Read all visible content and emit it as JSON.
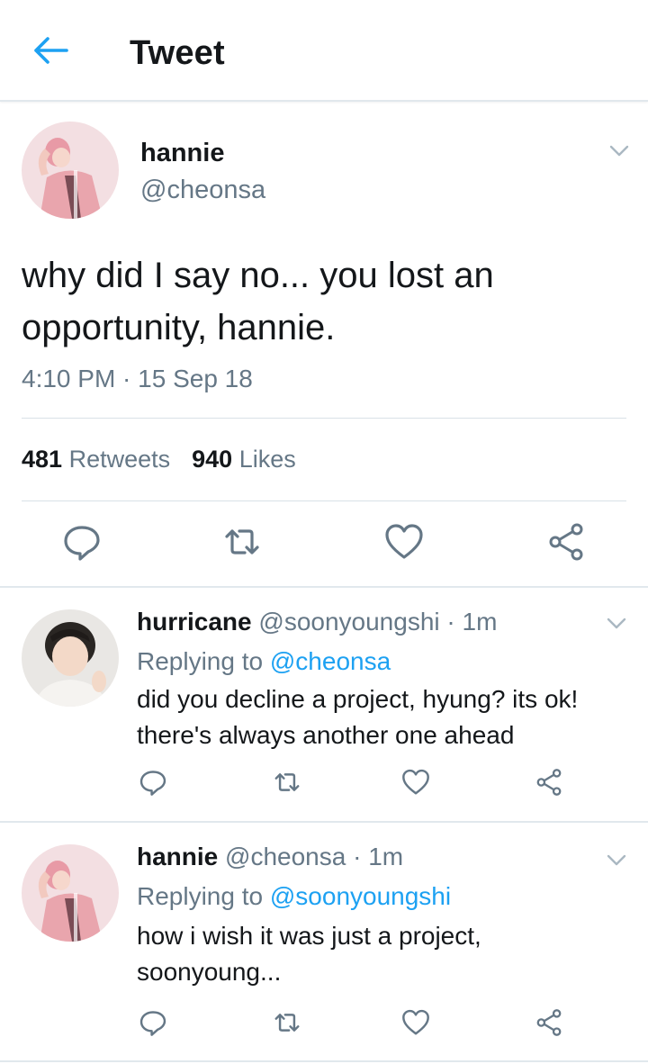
{
  "header": {
    "title": "Tweet",
    "back_icon": "back-arrow-icon"
  },
  "colors": {
    "accent": "#1da1f2",
    "secondary_text": "#657786",
    "primary_text": "#14171a",
    "divider": "#e1e8ed"
  },
  "tweet": {
    "author_name": "hannie",
    "author_handle": "@cheonsa",
    "text": "why did I say no... you lost an opportunity, hannie.",
    "timestamp": "4:10 PM · 15 Sep 18",
    "retweet_count": "481",
    "retweet_label": "Retweets",
    "like_count": "940",
    "like_label": "Likes",
    "actions": [
      "reply-icon",
      "retweet-icon",
      "like-icon",
      "share-icon"
    ]
  },
  "replies": [
    {
      "name": "hurricane",
      "handle": "@soonyoungshi",
      "time": "· 1m",
      "replying_label": "Replying to",
      "replying_to": "@cheonsa",
      "text": "did you decline a project, hyung? its ok! there's always another one ahead"
    },
    {
      "name": "hannie",
      "handle": "@cheonsa",
      "time": "· 1m",
      "replying_label": "Replying to",
      "replying_to": "@soonyoungshi",
      "text": "how i wish it was just a project, soonyoung..."
    }
  ]
}
